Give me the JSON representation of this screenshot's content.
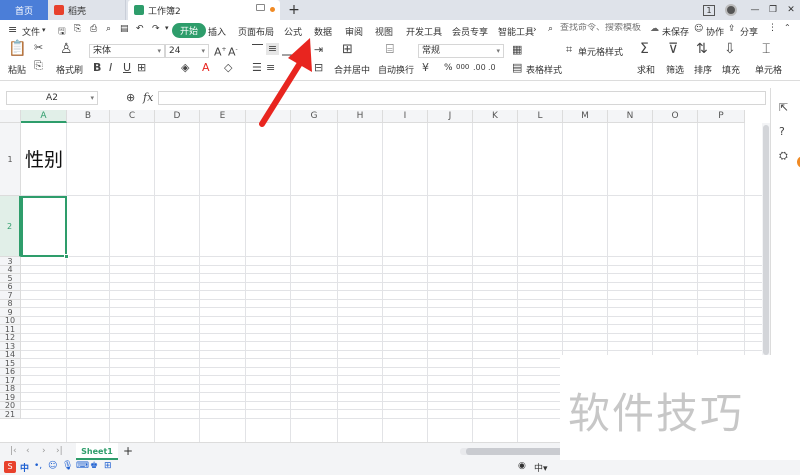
{
  "tabs": {
    "home": "首页",
    "docer": "稻壳",
    "workbook": "工作簿2",
    "new_tab": "+"
  },
  "window": {
    "counter": "1",
    "minimize": "—",
    "restore": "❐",
    "close": "✕"
  },
  "menu": {
    "file": "文件",
    "items": [
      "开始",
      "插入",
      "页面布局",
      "公式",
      "数据",
      "审阅",
      "视图",
      "开发工具",
      "会员专享",
      "智能工具"
    ],
    "search_placeholder": "查找命令、搜索模板",
    "unsaved": "未保存",
    "collab": "协作",
    "share": "分享"
  },
  "toolbar": {
    "paste": "粘贴",
    "format_painter": "格式刷",
    "font_name": "宋体",
    "font_size": "24",
    "merge_center": "合并居中",
    "wrap_text": "自动换行",
    "number_format": "常规",
    "percent": "%",
    "thousands": "000",
    "table_style": "表格样式",
    "cell_style": "单元格样式",
    "sum": "求和",
    "filter": "筛选",
    "sort": "排序",
    "fill": "填充",
    "row_col": "单元格"
  },
  "formula_bar": {
    "cell_ref": "A2",
    "fx": "fx",
    "content": ""
  },
  "grid": {
    "columns": [
      "A",
      "B",
      "C",
      "D",
      "E",
      "F",
      "G",
      "H",
      "I",
      "J",
      "K",
      "L",
      "M",
      "N",
      "O",
      "P"
    ],
    "rows": [
      "1",
      "2",
      "3",
      "4",
      "5",
      "6",
      "7",
      "8",
      "9",
      "10",
      "11",
      "12",
      "13",
      "14",
      "15",
      "16",
      "17",
      "18",
      "19",
      "20",
      "21"
    ],
    "cell_A1": "性别",
    "selected_cell": "A2"
  },
  "sheets": {
    "active": "Sheet1",
    "add": "+"
  },
  "watermark": "软件技巧",
  "colors": {
    "accent_green": "#2e9d6b",
    "arrow_red": "#e8251f",
    "tab_active_bg": "#ffffff",
    "home_tab_bg": "#4b7ed8"
  }
}
